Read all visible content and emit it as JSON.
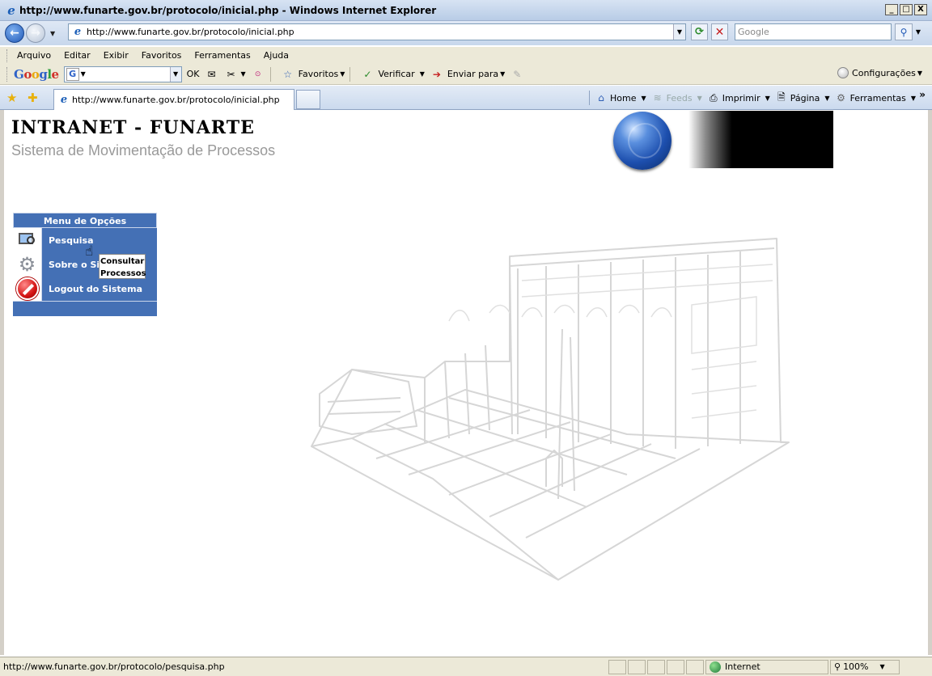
{
  "window": {
    "title": "http://www.funarte.gov.br/protocolo/inicial.php - Windows Internet Explorer",
    "buttons": {
      "minimize": "_",
      "maximize": "□",
      "close": "X"
    }
  },
  "address_bar": {
    "url": "http://www.funarte.gov.br/protocolo/inicial.php",
    "search_placeholder": "Google"
  },
  "menu_bar": [
    "Arquivo",
    "Editar",
    "Exibir",
    "Favoritos",
    "Ferramentas",
    "Ajuda"
  ],
  "google_toolbar": {
    "logo": [
      "G",
      "o",
      "o",
      "g",
      "l",
      "e"
    ],
    "ok_label": "OK",
    "favoritos_label": "Favoritos",
    "verificar_label": "Verificar",
    "enviar_label": "Enviar para",
    "config_label": "Configurações"
  },
  "tab_bar": {
    "tab_title": "http://www.funarte.gov.br/protocolo/inicial.php",
    "commands": {
      "home": "Home",
      "feeds": "Feeds",
      "imprimir": "Imprimir",
      "pagina": "Página",
      "ferramentas": "Ferramentas"
    }
  },
  "page": {
    "title": "INTRANET - FUNARTE",
    "subtitle": "Sistema de Movimentação de Processos",
    "menu": {
      "header": "Menu de Opções",
      "items": [
        {
          "label": "Pesquisa",
          "icon": "search-icon"
        },
        {
          "label": "Sobre o Sis",
          "icon": "gear-icon"
        },
        {
          "label": "Logout do Sistema",
          "icon": "logout-icon"
        }
      ],
      "submenu": [
        "Consultar",
        "Processos"
      ]
    }
  },
  "status_bar": {
    "text": "http://www.funarte.gov.br/protocolo/pesquisa.php",
    "zone": "Internet",
    "zoom": "100%"
  },
  "colors": {
    "menu_blue": "#4470b5",
    "subtitle_gray": "#999999"
  }
}
